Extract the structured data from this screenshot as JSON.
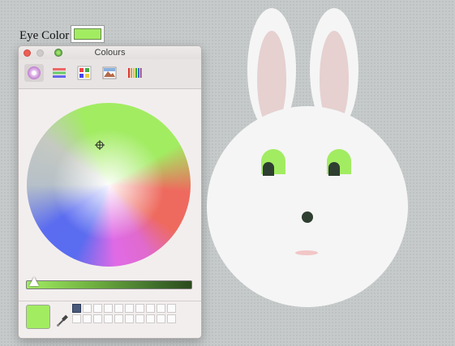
{
  "eye_color": {
    "label": "Eye Color",
    "value": "#a2ec62"
  },
  "panel": {
    "title": "Colours",
    "toolbar": [
      {
        "name": "colour-wheel-tab",
        "active": true
      },
      {
        "name": "colour-sliders-tab",
        "active": false
      },
      {
        "name": "colour-palettes-tab",
        "active": false
      },
      {
        "name": "image-palettes-tab",
        "active": false
      },
      {
        "name": "pencils-tab",
        "active": false
      }
    ],
    "brightness": 0.02,
    "current_color": "#a2ec62"
  },
  "colors": {
    "accent": "#a2ec62",
    "bunny_body": "#f5f5f5",
    "ear_inner": "#e6d0d0",
    "pupil": "#2e3e30",
    "mouth": "#f2c6c6"
  }
}
